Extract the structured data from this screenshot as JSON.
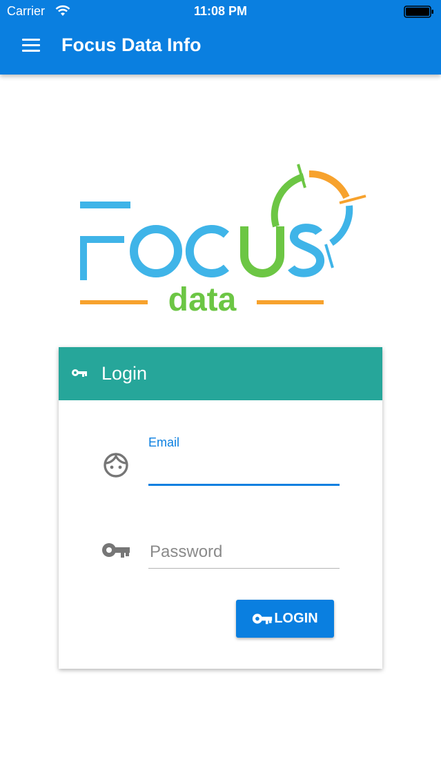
{
  "status_bar": {
    "carrier": "Carrier",
    "time": "11:08 PM",
    "icons": [
      "wifi-icon",
      "battery-icon"
    ]
  },
  "app_bar": {
    "title": "Focus Data Info",
    "menu_icon": "menu-icon",
    "color": "#0a7fe0"
  },
  "logo": {
    "word": "FOCUS",
    "subword": "data",
    "colors": {
      "blue": "#3fb4e8",
      "green": "#6cc644",
      "orange": "#f7a22d"
    }
  },
  "login_card": {
    "title": "Login",
    "header_color": "#26a69a",
    "email": {
      "label": "Email",
      "value": "",
      "icon": "face-icon"
    },
    "password": {
      "placeholder": "Password",
      "value": "",
      "icon": "key-icon"
    },
    "button_label": "LOGIN",
    "button_color": "#0a7fe0"
  }
}
